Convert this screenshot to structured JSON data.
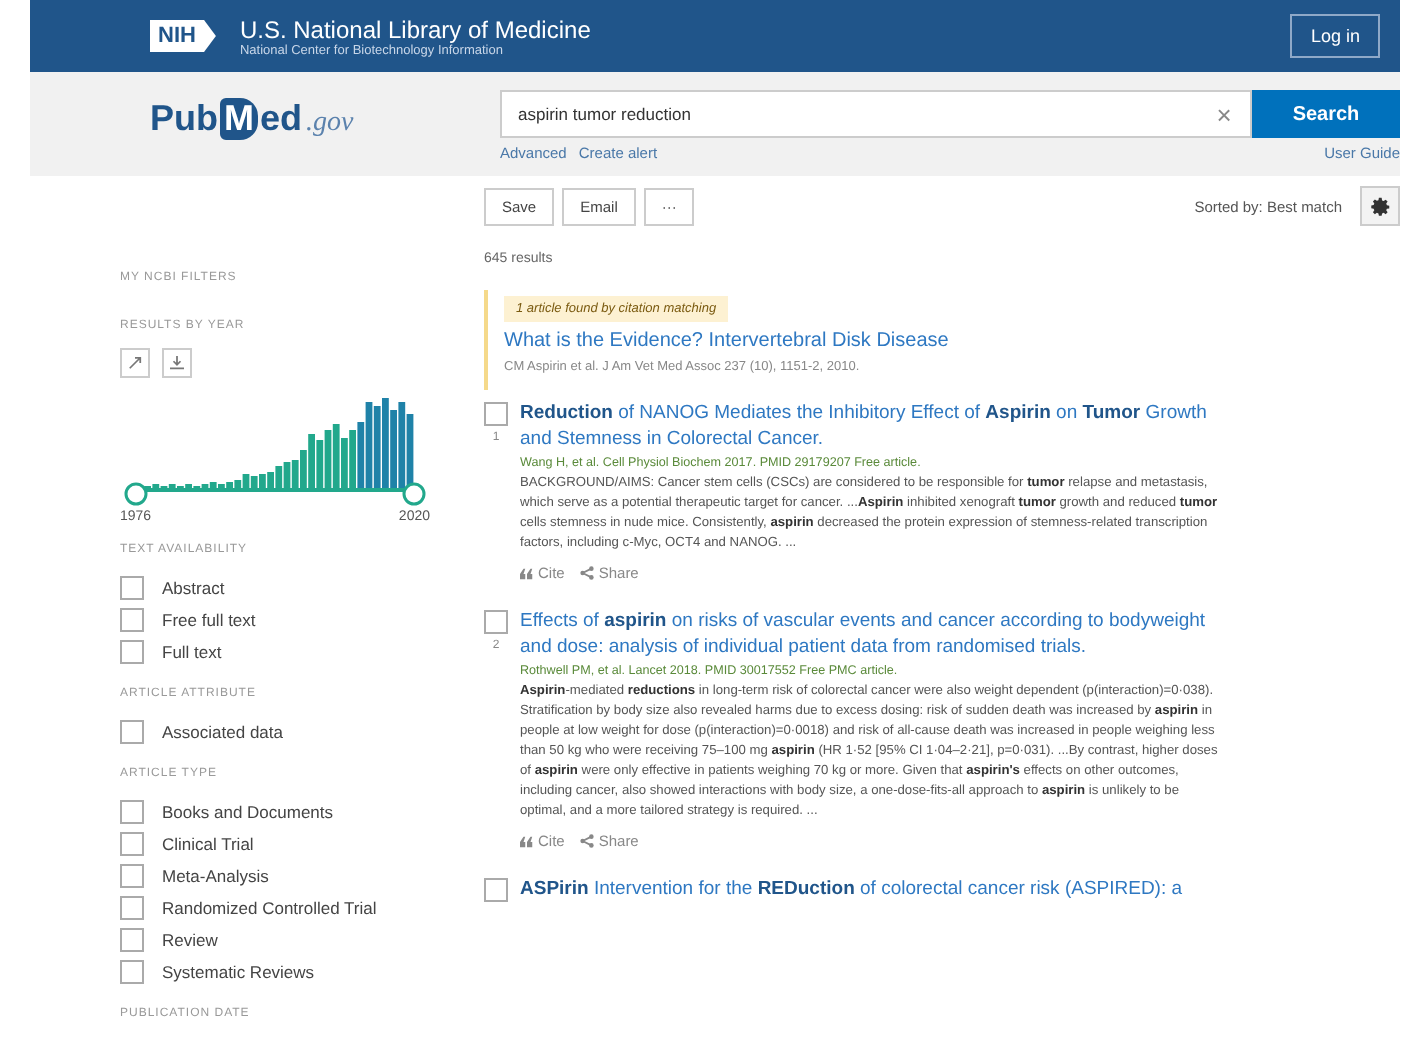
{
  "header": {
    "logo": "NIH",
    "title": "U.S. National Library of Medicine",
    "subtitle": "National Center for Biotechnology Information",
    "login": "Log in"
  },
  "search": {
    "logo_prefix": "Pub",
    "logo_badge": "M",
    "logo_suffix": "ed",
    "logo_domain": ".gov",
    "query": "aspirin tumor reduction",
    "clear": "×",
    "button": "Search",
    "links": [
      "Advanced",
      "Create alert"
    ],
    "guide": "User Guide"
  },
  "toolbar": {
    "buttons": [
      "Save",
      "Email",
      "···"
    ],
    "sort": "Sorted by: Best match"
  },
  "sidebar": {
    "filters_label": "MY NCBI FILTERS",
    "year_heading": "RESULTS BY YEAR",
    "year_start": "1976",
    "year_end": "2020",
    "sections": [
      {
        "heading": "TEXT AVAILABILITY",
        "items": [
          {
            "label": "Abstract",
            "checked": false
          },
          {
            "label": "Free full text",
            "checked": false
          },
          {
            "label": "Full text",
            "checked": false
          }
        ]
      },
      {
        "heading": "ARTICLE ATTRIBUTE",
        "items": [
          {
            "label": "Associated data",
            "checked": false
          }
        ]
      },
      {
        "heading": "ARTICLE TYPE",
        "items": [
          {
            "label": "Books and Documents",
            "checked": false
          },
          {
            "label": "Clinical Trial",
            "checked": false
          },
          {
            "label": "Meta-Analysis",
            "checked": false
          },
          {
            "label": "Randomized Controlled Trial",
            "checked": false
          },
          {
            "label": "Review",
            "checked": false
          },
          {
            "label": "Systematic Reviews",
            "checked": false
          }
        ]
      },
      {
        "heading": "PUBLICATION DATE"
      }
    ]
  },
  "results_count": "645 results",
  "citation_match": {
    "note": "1 article found by citation matching",
    "title": "What is the Evidence? Intervertebral Disk Disease",
    "citation": "CM Aspirin et al. J Am Vet Med Assoc 237 (10), 1151-2, 2010."
  },
  "results": [
    {
      "number": "1",
      "checked": false,
      "title": "**Reduction** of NANOG Mediates the Inhibitory Effect of **Aspirin** on **Tumor** Growth and Stemness in Colorectal Cancer.",
      "citation": "Wang H, et al. Cell Physiol Biochem 2017. PMID 29179207 Free article.",
      "snippet": "BACKGROUND/AIMS: Cancer stem cells (CSCs) are considered to be responsible for **tumor** relapse and metastasis, which serve as a potential therapeutic target for cancer. ...**Aspirin** inhibited xenograft **tumor** growth and reduced **tumor** cells stemness in nude mice. Consistently, **aspirin** decreased the protein expression of stemness-related transcription factors, including c-Myc, OCT4 and NANOG. ...",
      "actions": [
        "Cite",
        "Share"
      ]
    },
    {
      "number": "2",
      "checked": false,
      "title": "Effects of **aspirin** on risks of vascular events and cancer according to bodyweight and dose: analysis of individual patient data from randomised trials.",
      "citation": "Rothwell PM, et al. Lancet 2018. PMID 30017552 Free PMC article.",
      "snippet": "**Aspirin**-mediated **reductions** in long-term risk of colorectal cancer were also weight dependent (p(interaction)=0·038). Stratification by body size also revealed harms due to excess dosing: risk of sudden death was increased by **aspirin** in people at low weight for dose (p(interaction)=0·0018) and risk of all-cause death was increased in people weighing less than 50 kg who were receiving 75–100 mg **aspirin** (HR 1·52 [95% CI 1·04–2·21], p=0·031). ...By contrast, higher doses of **aspirin** were only effective in patients weighing 70 kg or more. Given that **aspirin's** effects on other outcomes, including cancer, also showed interactions with body size, a one-dose-fits-all approach to **aspirin** is unlikely to be optimal, and a more tailored strategy is required. ...",
      "actions": [
        "Cite",
        "Share"
      ]
    },
    {
      "checked": false,
      "title": "**ASPirin** Intervention for the **REDuction** of colorectal cancer risk (ASPIRED): a"
    }
  ]
}
